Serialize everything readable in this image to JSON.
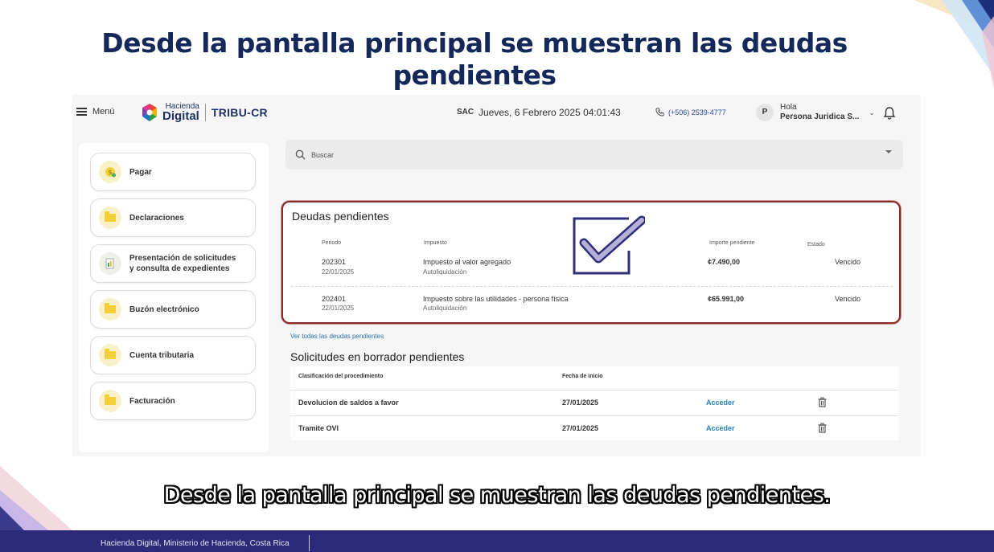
{
  "slide": {
    "title": "Desde la pantalla principal se muestran las deudas pendientes",
    "subtitle": "Desde la pantalla principal se muestran las deudas pendientes.",
    "footer": "Hacienda Digital, Ministerio de Hacienda, Costa Rica"
  },
  "header": {
    "menu_label": "Menú",
    "logo_line1": "Hacienda",
    "logo_line2": "Digital",
    "app_name": "TRIBU-CR",
    "sac": "SAC",
    "datetime": "Jueves, 6 Febrero 2025 04:01:43",
    "phone": "(+506) 2539-4777",
    "avatar_initial": "P",
    "greeting": "Hola",
    "user_name": "Persona Juridica S..."
  },
  "sidebar": {
    "items": [
      {
        "label": "Pagar",
        "icon": "coin-icon"
      },
      {
        "label": "Declaraciones",
        "icon": "folder-icon"
      },
      {
        "label": "Presentación de solicitudes y consulta de expedientes",
        "icon": "documents-icon"
      },
      {
        "label": "Buzón electrónico",
        "icon": "folder-icon"
      },
      {
        "label": "Cuenta tributaria",
        "icon": "folder-icon"
      },
      {
        "label": "Facturación",
        "icon": "folder-icon"
      }
    ]
  },
  "search": {
    "placeholder": "Buscar"
  },
  "debts": {
    "title": "Deudas pendientes",
    "headers": {
      "period": "Periodo",
      "tax": "Impuesto",
      "amount": "Importe pendiente",
      "status": "Estado"
    },
    "rows": [
      {
        "period": "202301",
        "date": "22/01/2025",
        "tax": "Impuesto al valor agregado",
        "type": "Autoliquidación",
        "amount": "¢7.490,00",
        "status": "Vencido"
      },
      {
        "period": "202401",
        "date": "22/01/2025",
        "tax": "Impuesto sobre las utilidades - persona física",
        "type": "Autoliquidación",
        "amount": "¢65.991,00",
        "status": "Vencido"
      }
    ],
    "link_all": "Ver todas las deudas pendientes"
  },
  "drafts": {
    "title": "Solicitudes en borrador pendientes",
    "headers": {
      "classification": "Clasificación del procedimiento",
      "start_date": "Fecha de inicio"
    },
    "rows": [
      {
        "name": "Devolucion de saldos a favor",
        "date": "27/01/2025",
        "action": "Acceder"
      },
      {
        "name": "Tramite OVI",
        "date": "27/01/2025",
        "action": "Acceder"
      }
    ]
  },
  "colors": {
    "title": "#14285a",
    "highlight_border": "#8a2a2a",
    "check": "#2e2e7a",
    "footer": "#2c2a78",
    "link": "#2a6fb0"
  }
}
